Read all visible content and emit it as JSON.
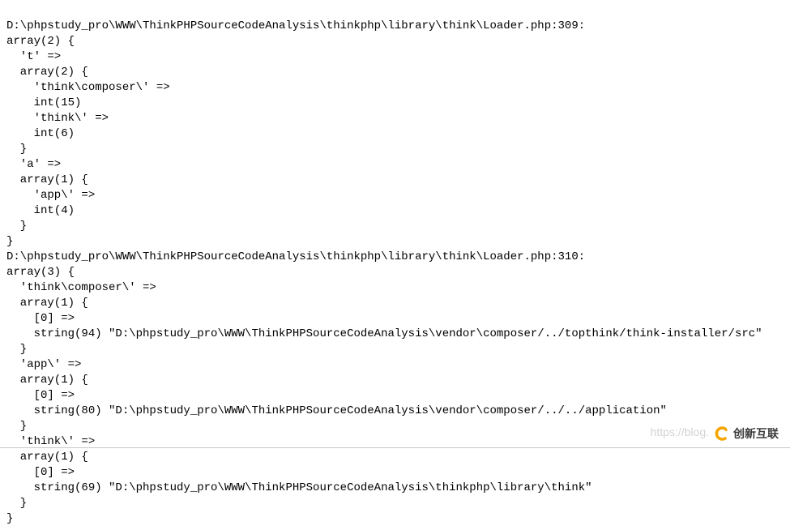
{
  "dump1": {
    "file_line": "D:\\phpstudy_pro\\WWW\\ThinkPHPSourceCodeAnalysis\\thinkphp\\library\\think\\Loader.php:309:",
    "root": "array(2) {",
    "k_t": "  't' =>",
    "t_arr": "  array(2) {",
    "t_k1": "    'think\\composer\\' =>",
    "t_v1": "    int(15)",
    "t_k2": "    'think\\' =>",
    "t_v2": "    int(6)",
    "t_close": "  }",
    "k_a": "  'a' =>",
    "a_arr": "  array(1) {",
    "a_k1": "    'app\\' =>",
    "a_v1": "    int(4)",
    "a_close": "  }",
    "root_close": "}"
  },
  "dump2": {
    "file_line": "D:\\phpstudy_pro\\WWW\\ThinkPHPSourceCodeAnalysis\\thinkphp\\library\\think\\Loader.php:310:",
    "root": "array(3) {",
    "k1": "  'think\\composer\\' =>",
    "a1": "  array(1) {",
    "a1_k": "    [0] =>",
    "a1_v": "    string(94) \"D:\\phpstudy_pro\\WWW\\ThinkPHPSourceCodeAnalysis\\vendor\\composer/../topthink/think-installer/src\"",
    "a1_close": "  }",
    "k2": "  'app\\' =>",
    "a2": "  array(1) {",
    "a2_k": "    [0] =>",
    "a2_v": "    string(80) \"D:\\phpstudy_pro\\WWW\\ThinkPHPSourceCodeAnalysis\\vendor\\composer/../../application\"",
    "a2_close": "  }",
    "k3": "  'think\\' =>",
    "a3": "  array(1) {",
    "a3_k": "    [0] =>",
    "a3_v": "    string(69) \"D:\\phpstudy_pro\\WWW\\ThinkPHPSourceCodeAnalysis\\thinkphp\\library\\think\"",
    "a3_close": "  }",
    "root_close": "}"
  },
  "watermark": {
    "blog": "https://blog.",
    "logo_text": "创新互联"
  }
}
